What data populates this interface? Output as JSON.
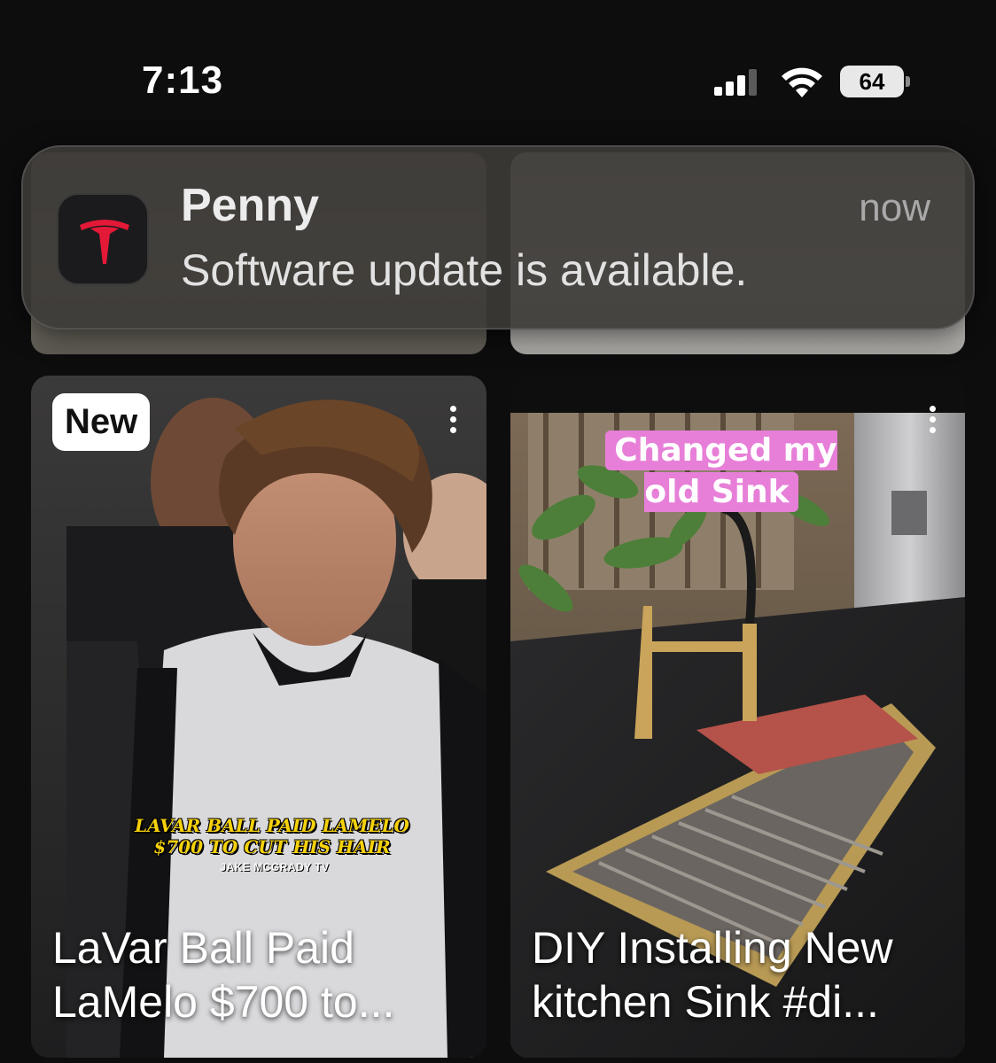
{
  "status_bar": {
    "time": "7:13",
    "battery": "64"
  },
  "notification": {
    "app_icon": "tesla-logo-icon",
    "title": "Penny",
    "body": "Software update is available.",
    "time": "now",
    "accent_color": "#e31937"
  },
  "feed": {
    "cards": [
      {
        "badge": "New",
        "overlay_headline_line1": "LAVAR BALL PAID LAMELO",
        "overlay_headline_line2": "$700 TO CUT HIS HAIR",
        "overlay_credit": "JAKE MCGRADY TV",
        "caption": "LaVar Ball Paid LaMelo $700 to..."
      },
      {
        "overlay_label": "Changed my old Sink",
        "caption": "DIY Installing New kitchen Sink #di..."
      }
    ]
  }
}
